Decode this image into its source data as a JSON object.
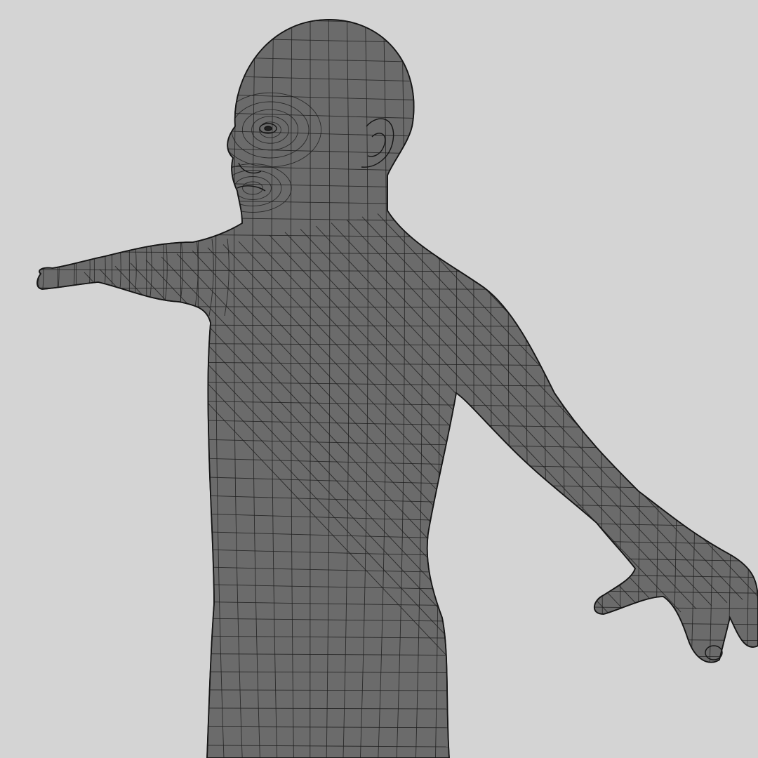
{
  "scene": {
    "background_color": "#d4d4d4",
    "mesh_fill_color": "#6b6b6b",
    "wireframe_color": "#1f1f1f",
    "subject": "base-mesh-human-male-t-pose",
    "display_mode": "wireframe-on-shaded"
  }
}
